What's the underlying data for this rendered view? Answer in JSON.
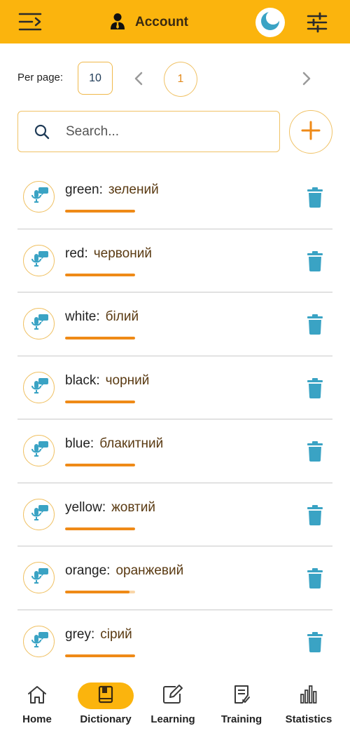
{
  "header": {
    "account_label": "Account",
    "icons": {
      "menu": "menu-collapse-icon",
      "account": "user-tie-icon",
      "theme": "moon-icon",
      "filter": "sliders-icon"
    }
  },
  "pagination": {
    "per_page_label": "Per page:",
    "per_page_value": "10",
    "current_page": "1"
  },
  "search": {
    "placeholder": "Search..."
  },
  "words": [
    {
      "en": "green",
      "ua": "зелений",
      "progress": 1.0
    },
    {
      "en": "red",
      "ua": "червоний",
      "progress": 1.0
    },
    {
      "en": "white",
      "ua": "білий",
      "progress": 1.0
    },
    {
      "en": "black",
      "ua": "чорний",
      "progress": 1.0
    },
    {
      "en": "blue",
      "ua": "блакитний",
      "progress": 1.0
    },
    {
      "en": "yellow",
      "ua": "жовтий",
      "progress": 1.0
    },
    {
      "en": "orange",
      "ua": "оранжевий",
      "progress": 0.92
    },
    {
      "en": "grey",
      "ua": "сірий",
      "progress": 1.0
    }
  ],
  "nav": {
    "items": [
      {
        "label": "Home",
        "icon": "home-icon",
        "active": false
      },
      {
        "label": "Dictionary",
        "icon": "book-icon",
        "active": true
      },
      {
        "label": "Learning",
        "icon": "edit-icon",
        "active": false
      },
      {
        "label": "Training",
        "icon": "checklist-icon",
        "active": false
      },
      {
        "label": "Statistics",
        "icon": "bar-chart-icon",
        "active": false
      }
    ]
  },
  "colors": {
    "accent": "#fbb40d",
    "progress": "#ef8a17",
    "delete": "#3aa3c4",
    "speak_bubble": "#3aa3c4"
  }
}
